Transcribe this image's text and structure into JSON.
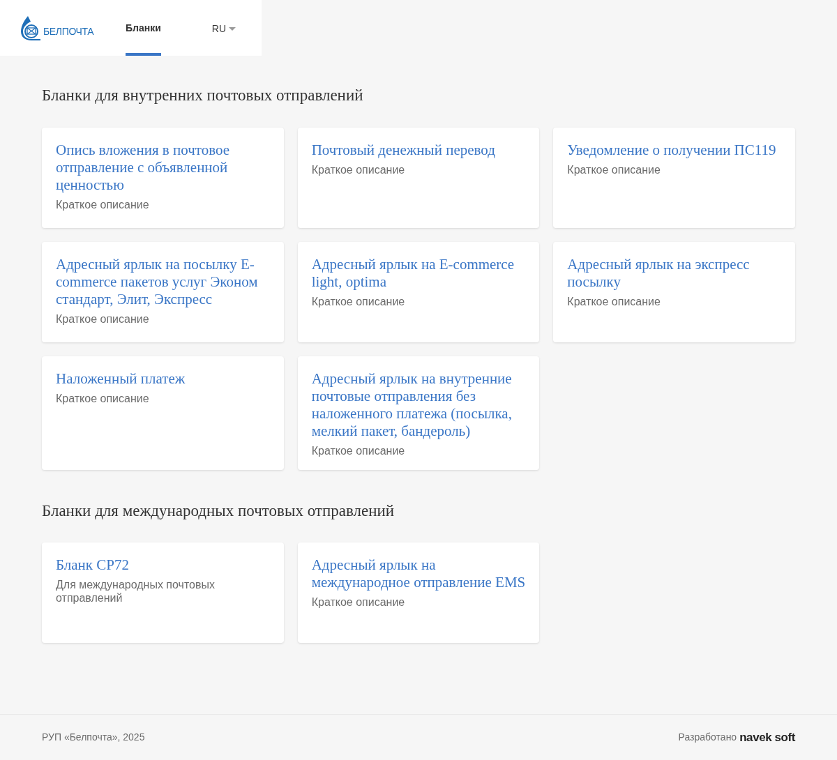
{
  "header": {
    "logo_text": "БЕЛПОЧТА",
    "tabs": [
      {
        "label": "Бланки",
        "selected": true
      }
    ],
    "language": "RU"
  },
  "sections": [
    {
      "title": "Бланки для внутренних почтовых отправлений",
      "cards": [
        {
          "title": "Опись вложения в почтовое отправление с объявленной ценностью",
          "description": "Краткое описание"
        },
        {
          "title": "Почтовый денежный перевод",
          "description": "Краткое описание"
        },
        {
          "title": "Уведомление о получении ПС119",
          "description": "Краткое описание"
        },
        {
          "title": "Адресный ярлык на посылку E-commerce пакетов услуг Эконом стандарт, Элит, Экспресс",
          "description": "Краткое описание"
        },
        {
          "title": "Адресный ярлык на E-commerce light, optima",
          "description": "Краткое описание"
        },
        {
          "title": "Адресный ярлык на экспресс посылку",
          "description": "Краткое описание"
        },
        {
          "title": "Наложенный платеж",
          "description": "Краткое описание"
        },
        {
          "title": "Адресный ярлык на внутренние почтовые отправления без наложенного платежа (посылка, мелкий пакет, бандероль)",
          "description": "Краткое описание"
        }
      ]
    },
    {
      "title": "Бланки для международных почтовых отправлений",
      "cards": [
        {
          "title": "Бланк СР72",
          "description": "Для международных почтовых отправлений"
        },
        {
          "title": "Адресный ярлык на международное отправление EMS",
          "description": "Краткое описание"
        }
      ]
    }
  ],
  "footer": {
    "copyright": "РУП «Белпочта», 2025",
    "developed_by": "Разработано",
    "developer_logo": "navek soft"
  }
}
